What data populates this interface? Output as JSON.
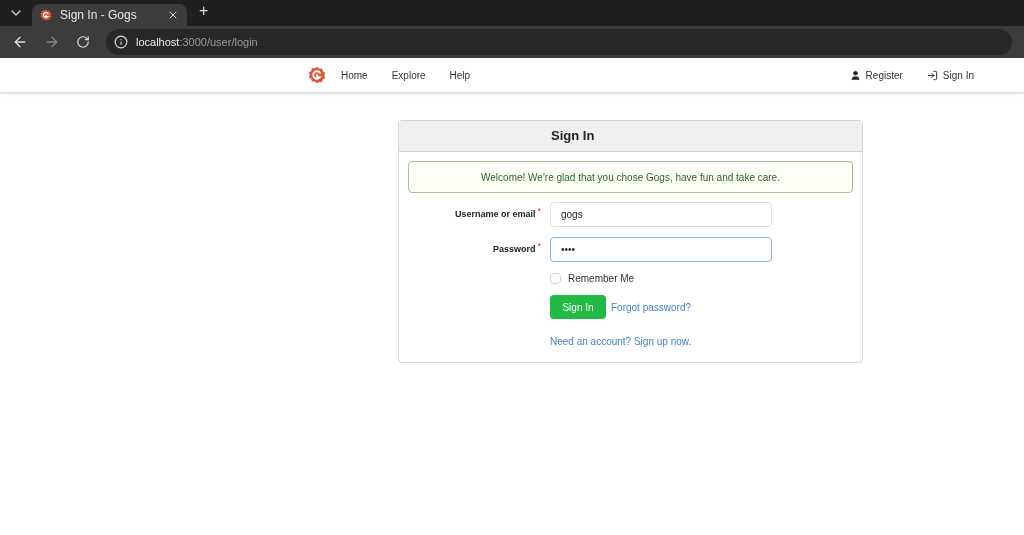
{
  "browser": {
    "tabs": [
      {
        "title": "Sign In - Gogs",
        "selected": true
      }
    ],
    "new_tab": "+",
    "address": {
      "host": "localhost",
      "path": ":3000/user/login"
    }
  },
  "nav": {
    "links": [
      {
        "label": "Home"
      },
      {
        "label": "Explore"
      },
      {
        "label": "Help"
      }
    ],
    "right_links": [
      {
        "label": "Register",
        "kind": "user"
      },
      {
        "label": "Sign In",
        "kind": "signin"
      }
    ]
  },
  "card": {
    "title": "Sign In",
    "message": "Welcome! We're glad that you chose Gogs, have fun and take care.",
    "fields": [
      {
        "label": "Username or email",
        "required_mark": "*",
        "value": "gogs",
        "focused": false
      },
      {
        "label": "Password",
        "required_mark": "*",
        "value": "••••",
        "focused": true
      }
    ],
    "remember": {
      "label": "Remember Me",
      "checked": false
    },
    "submit": "Sign In",
    "forgot": "Forgot password?",
    "signup": "Need an account? Sign up now."
  }
}
